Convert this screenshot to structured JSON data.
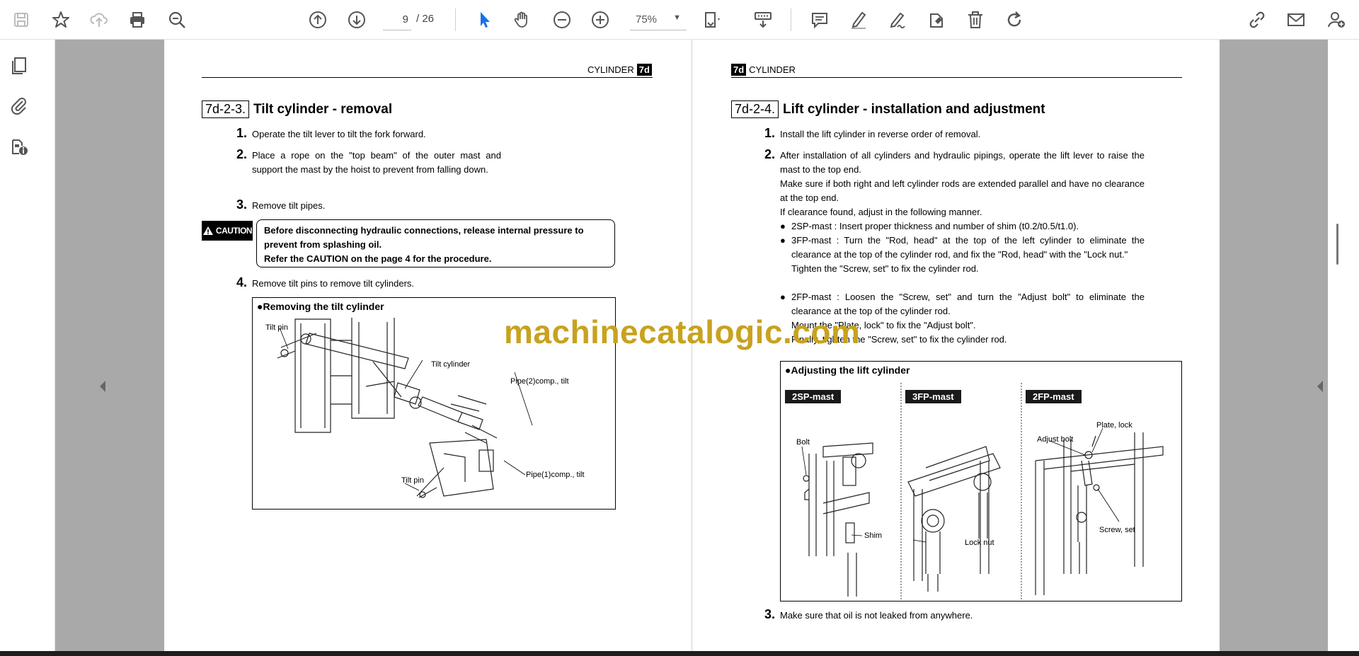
{
  "toolbar": {
    "icons": [
      "save-icon",
      "bookmark-star-icon",
      "upload-cloud-icon",
      "print-icon",
      "zoom-search-icon",
      "page-up-icon",
      "page-down-icon",
      "select-cursor-icon",
      "hand-pan-icon",
      "zoom-out-icon",
      "zoom-in-icon",
      "fit-page-icon",
      "scroll-mode-icon",
      "comment-icon",
      "highlight-icon",
      "sign-icon",
      "stamp-icon",
      "delete-icon",
      "rotate-icon",
      "share-link-icon",
      "email-icon",
      "add-user-icon"
    ],
    "page_current": "9",
    "page_total": "/ 26",
    "zoom": "75%"
  },
  "left_page": {
    "header_text": "CYLINDER",
    "header_badge": "7d",
    "section_num": "7d-2-3.",
    "section_title": "Tilt cylinder - removal",
    "steps": [
      {
        "n": "1.",
        "text": "Operate the tilt lever to tilt the fork forward."
      },
      {
        "n": "2.",
        "text": "Place a rope on the \"top beam\" of the outer mast and support the mast by the hoist to prevent from falling down."
      },
      {
        "n": "3.",
        "text": "Remove tilt pipes."
      },
      {
        "n": "4.",
        "text": "Remove tilt pins to remove tilt cylinders."
      }
    ],
    "caution_label": "CAUTION",
    "caution_lines": [
      "Before disconnecting hydraulic connections, release internal pressure to prevent from splashing oil.",
      "Refer the CAUTION on the page 4 for the procedure."
    ],
    "figure_title": "●Removing the tilt cylinder",
    "figure_labels": [
      "Tilt pin",
      "Tilt cylinder",
      "Pipe(2)comp., tilt",
      "Pipe(1)comp., tilt",
      "Tilt pin"
    ]
  },
  "right_page": {
    "header_badge": "7d",
    "header_text": "CYLINDER",
    "section_num": "7d-2-4.",
    "section_title": "Lift cylinder - installation and adjustment",
    "step1": "Install the lift cylinder in reverse order of removal.",
    "step2_lines": [
      "After installation of all cylinders and hydraulic pipings, operate the lift lever to raise the mast to the top end.",
      "Make sure if both right and left cylinder rods are extended parallel and have no clearance at the top end.",
      "If clearance found, adjust in the following manner."
    ],
    "bullets": [
      {
        "text": "2SP-mast : Insert proper thickness and number of shim (t0.2/t0.5/t1.0)."
      },
      {
        "text": "3FP-mast : Turn the \"Rod, head\" at the top of the left cylinder to eliminate the clearance at the top of the cylinder rod, and fix the \"Rod, head\" with the \"Lock nut.\"",
        "extra": "Tighten the \"Screw, set\" to fix the cylinder rod."
      },
      {
        "text": "2FP-mast : Loosen the \"Screw, set\" and turn the \"Adjust bolt\" to eliminate the clearance at the top of the cylinder rod.",
        "extra": "Mount the \"Plate, lock\" to fix the \"Adjust bolt\".",
        "extra2": "Finally, tighten the \"Screw, set\" to fix the cylinder rod."
      }
    ],
    "step3": "Make sure that oil is not leaked from anywhere.",
    "figure_title": "●Adjusting the lift cylinder",
    "mast_tags": [
      "2SP-mast",
      "3FP-mast",
      "2FP-mast"
    ],
    "figure_labels": [
      "Bolt",
      "Shim",
      "Lock nut",
      "Plate, lock",
      "Adjust bolt",
      "Screw, set"
    ]
  },
  "watermark": "machinecatalogic.com"
}
